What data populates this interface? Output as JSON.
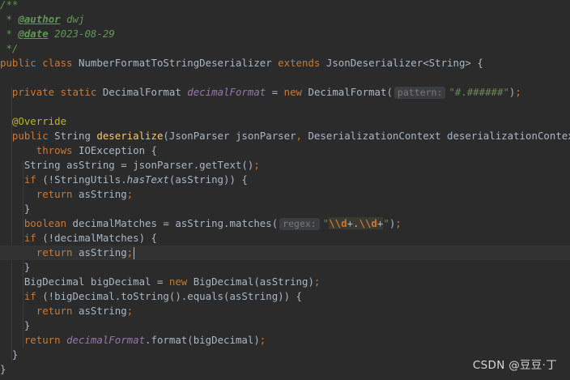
{
  "editor": {
    "lines": [
      [
        {
          "c": "doc",
          "t": "/**"
        }
      ],
      [
        {
          "c": "doc",
          "t": " * "
        },
        {
          "c": "doc-tag",
          "t": "@author"
        },
        {
          "c": "doc",
          "t": " dwj"
        }
      ],
      [
        {
          "c": "doc",
          "t": " * "
        },
        {
          "c": "doc-tag",
          "t": "@date"
        },
        {
          "c": "doc",
          "t": " 2023-08-29"
        }
      ],
      [
        {
          "c": "doc",
          "t": " */"
        }
      ],
      [
        {
          "c": "kw",
          "t": "public class "
        },
        {
          "c": "plain",
          "t": "NumberFormatToStringDeserializer "
        },
        {
          "c": "kw",
          "t": "extends "
        },
        {
          "c": "plain",
          "t": "JsonDeserializer<String> {"
        }
      ],
      [],
      [
        {
          "c": "kw",
          "t": "  private static "
        },
        {
          "c": "plain",
          "t": "DecimalFormat "
        },
        {
          "c": "field",
          "t": "decimalFormat"
        },
        {
          "c": "plain",
          "t": " = "
        },
        {
          "c": "kw",
          "t": "new "
        },
        {
          "c": "plain",
          "t": "DecimalFormat("
        },
        {
          "c": "hint",
          "t": "pattern:"
        },
        {
          "c": "str",
          "t": "\"#.######\""
        },
        {
          "c": "plain",
          "t": ")"
        },
        {
          "c": "kw",
          "t": ";"
        }
      ],
      [],
      [
        {
          "c": "anno",
          "t": "  @Override"
        }
      ],
      [
        {
          "c": "kw",
          "t": "  public "
        },
        {
          "c": "plain",
          "t": "String "
        },
        {
          "c": "fn-decl",
          "t": "deserialize"
        },
        {
          "c": "plain",
          "t": "(JsonParser jsonParser"
        },
        {
          "c": "kw",
          "t": ", "
        },
        {
          "c": "plain",
          "t": "DeserializationContext deserializationContext)"
        }
      ],
      [
        {
          "c": "kw",
          "t": "      throws "
        },
        {
          "c": "plain",
          "t": "IOException {"
        }
      ],
      [
        {
          "c": "plain",
          "t": "    String asString = jsonParser.getText()"
        },
        {
          "c": "kw",
          "t": ";"
        }
      ],
      [
        {
          "c": "kw",
          "t": "    if "
        },
        {
          "c": "plain",
          "t": "(!StringUtils."
        },
        {
          "c": "static-call",
          "t": "hasText"
        },
        {
          "c": "plain",
          "t": "(asString)) {"
        }
      ],
      [
        {
          "c": "kw",
          "t": "      return "
        },
        {
          "c": "plain",
          "t": "asString"
        },
        {
          "c": "kw",
          "t": ";"
        }
      ],
      [
        {
          "c": "plain",
          "t": "    }"
        }
      ],
      [
        {
          "c": "kw",
          "t": "    boolean "
        },
        {
          "c": "plain",
          "t": "decimalMatches = asString.matches("
        },
        {
          "c": "hint",
          "t": "regex:"
        },
        {
          "c": "str",
          "t": "\""
        },
        {
          "c": "regex",
          "t": "\\\\d+.\\\\d+"
        },
        {
          "c": "str",
          "t": "\""
        },
        {
          "c": "plain",
          "t": ")"
        },
        {
          "c": "kw",
          "t": ";"
        }
      ],
      [
        {
          "c": "kw",
          "t": "    if "
        },
        {
          "c": "plain",
          "t": "(!decimalMatches) {"
        }
      ],
      [
        {
          "c": "kw",
          "t": "      return "
        },
        {
          "c": "plain",
          "t": "asString"
        },
        {
          "c": "kw",
          "t": ";"
        },
        {
          "c": "caret",
          "t": ""
        }
      ],
      [
        {
          "c": "plain",
          "t": "    }"
        }
      ],
      [
        {
          "c": "plain",
          "t": "    BigDecimal bigDecimal = "
        },
        {
          "c": "kw",
          "t": "new "
        },
        {
          "c": "plain",
          "t": "BigDecimal(asString)"
        },
        {
          "c": "kw",
          "t": ";"
        }
      ],
      [
        {
          "c": "kw",
          "t": "    if "
        },
        {
          "c": "plain",
          "t": "(!bigDecimal.toString().equals(asString)) {"
        }
      ],
      [
        {
          "c": "kw",
          "t": "      return "
        },
        {
          "c": "plain",
          "t": "asString"
        },
        {
          "c": "kw",
          "t": ";"
        }
      ],
      [
        {
          "c": "plain",
          "t": "    }"
        }
      ],
      [
        {
          "c": "kw",
          "t": "    return "
        },
        {
          "c": "field",
          "t": "decimalFormat"
        },
        {
          "c": "plain",
          "t": ".format(bigDecimal)"
        },
        {
          "c": "kw",
          "t": ";"
        }
      ],
      [
        {
          "c": "plain",
          "t": "  }"
        }
      ],
      [
        {
          "c": "plain",
          "t": "}"
        }
      ]
    ]
  },
  "watermark": "CSDN @豆豆·丁"
}
